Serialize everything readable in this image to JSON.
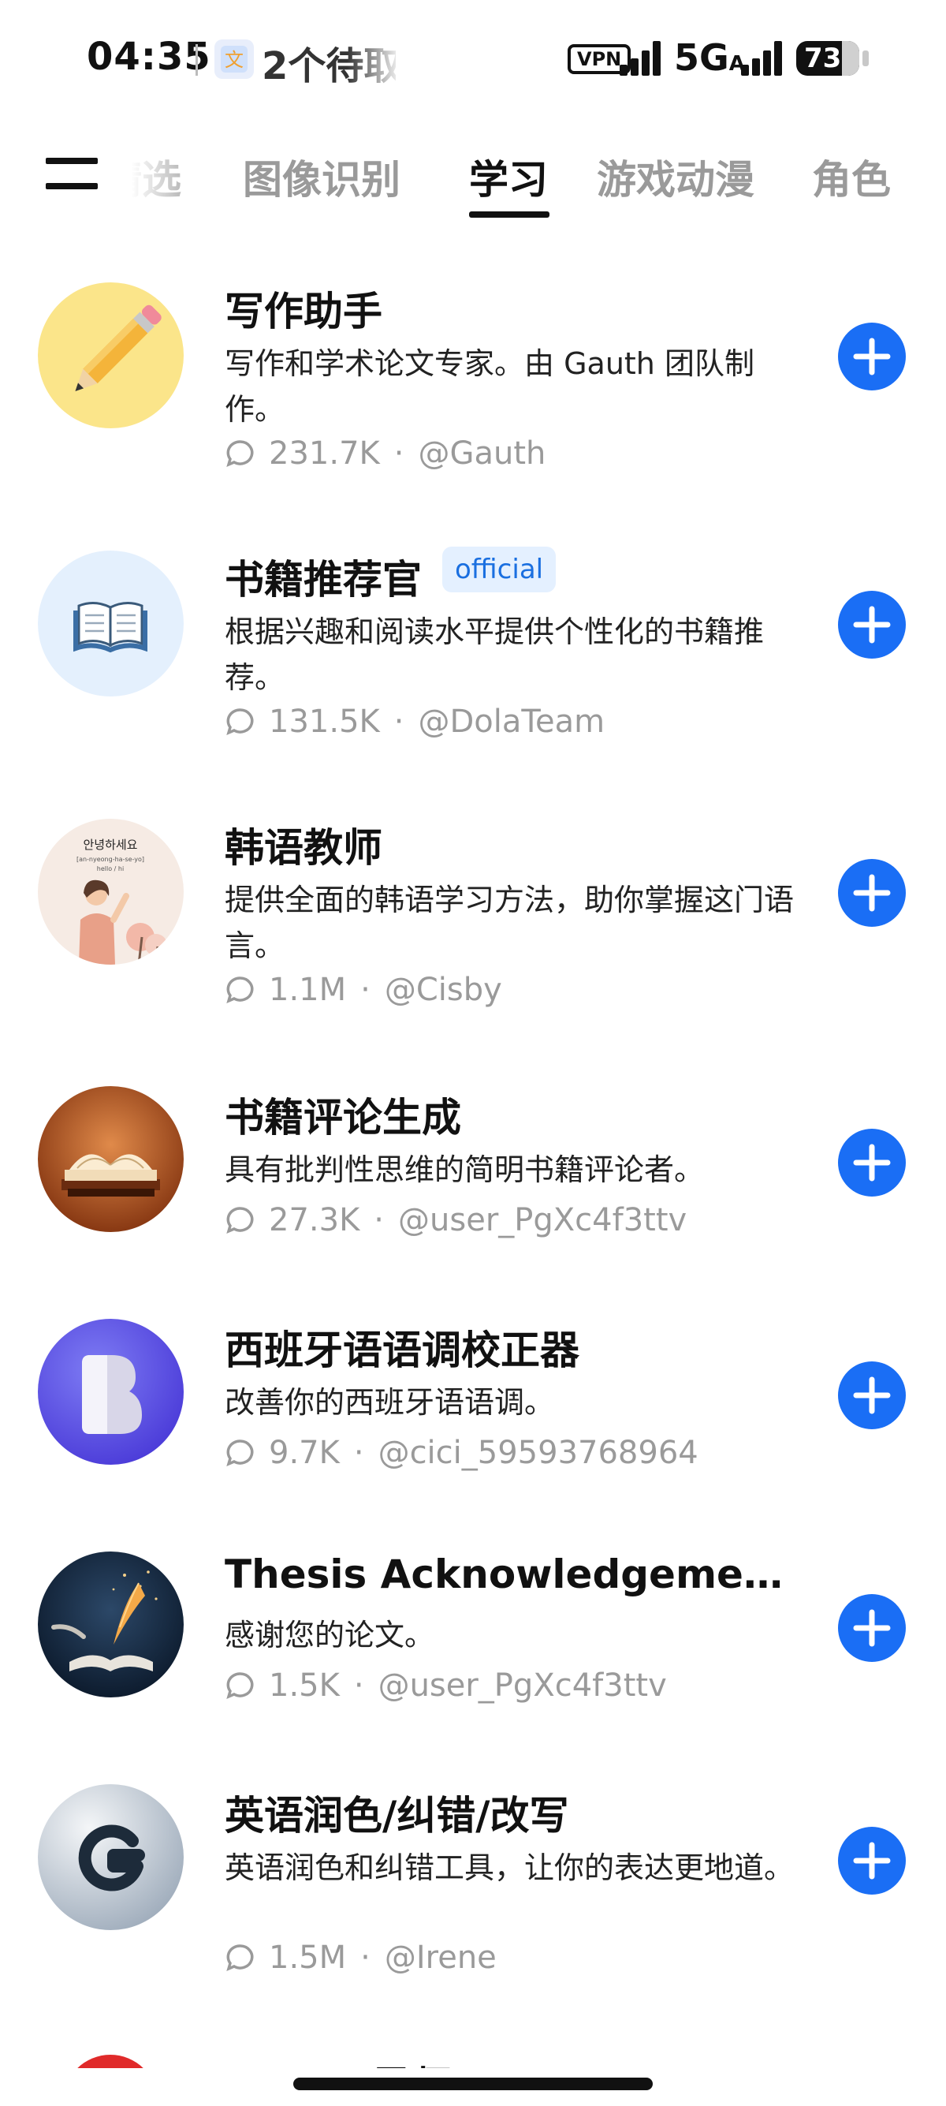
{
  "status_bar": {
    "time": "04:35",
    "notification": "2个待取",
    "vpn": "VPN",
    "network": "5G",
    "network_sub": "A",
    "battery": "73"
  },
  "tabs": [
    {
      "label": "精选",
      "active": false
    },
    {
      "label": "图像识别",
      "active": false
    },
    {
      "label": "学习",
      "active": true
    },
    {
      "label": "游戏动漫",
      "active": false
    },
    {
      "label": "角色",
      "active": false
    }
  ],
  "items": [
    {
      "title": "写作助手",
      "badge": "",
      "desc": "写作和学术论文专家。由 Gauth 团队制作。",
      "count": "231.7K",
      "author": "@Gauth",
      "avatar": "pencil-icon"
    },
    {
      "title": "书籍推荐官",
      "badge": "official",
      "desc": "根据兴趣和阅读水平提供个性化的书籍推荐。",
      "count": "131.5K",
      "author": "@DolaTeam",
      "avatar": "open-book-icon"
    },
    {
      "title": "韩语教师",
      "badge": "",
      "desc": "提供全面的韩语学习方法，助你掌握这门语言。",
      "count": "1.1M",
      "author": "@Cisby",
      "avatar": "korean-teacher-illustration",
      "avatar_text": [
        "안녕하세요",
        "[an-nyeong-ha-se-yo]",
        "hello / hi"
      ]
    },
    {
      "title": "书籍评论生成",
      "badge": "",
      "desc": "具有批判性思维的简明书籍评论者。",
      "count": "27.3K",
      "author": "@user_PgXc4f3ttv",
      "avatar": "books-photo"
    },
    {
      "title": "西班牙语语调校正器",
      "badge": "",
      "desc": "改善你的西班牙语语调。",
      "count": "9.7K",
      "author": "@cici_59593768964",
      "avatar": "letter-b-logo"
    },
    {
      "title": "Thesis Acknowledgement ...",
      "badge": "",
      "desc": "感谢您的论文。",
      "count": "1.5K",
      "author": "@user_PgXc4f3ttv",
      "avatar": "quill-book-illustration"
    },
    {
      "title": "英语润色/纠错/改写",
      "badge": "",
      "desc": "英语润色和纠错工具，让你的表达更地道。",
      "count": "1.5M",
      "author": "@Irene",
      "avatar": "letter-g-logo"
    }
  ],
  "partial_item": {
    "title": "Gauth 导师"
  },
  "colors": {
    "accent": "#1a6ef5",
    "badge_bg": "#e4f0ff",
    "badge_text": "#1a6fe0",
    "muted": "#9a9a9a"
  }
}
